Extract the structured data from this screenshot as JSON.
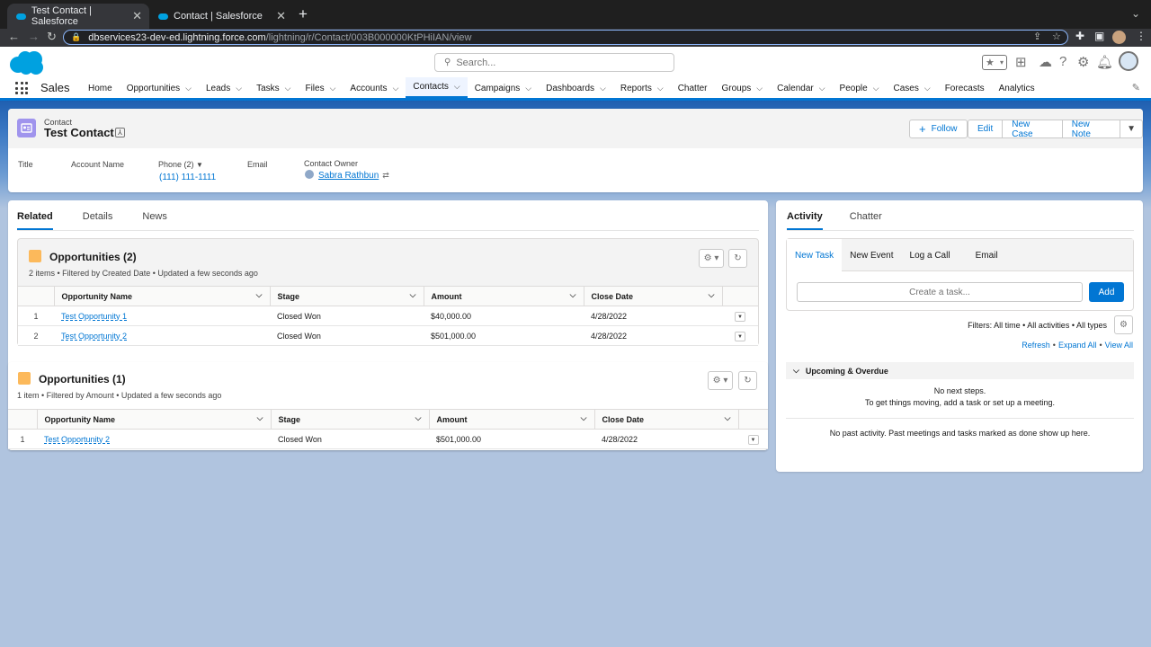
{
  "browser": {
    "tabs": [
      {
        "title": "Test Contact | Salesforce",
        "close": "✕"
      },
      {
        "title": "Contact | Salesforce",
        "close": "✕"
      }
    ],
    "new_tab": "+",
    "url_host": "dbservices23-dev-ed.lightning.force.com",
    "url_path": "/lightning/r/Contact/003B000000KtPHiIAN/view"
  },
  "header": {
    "search_placeholder": "Search...",
    "app_name": "Sales",
    "nav": [
      {
        "label": "Home",
        "dropdown": false
      },
      {
        "label": "Opportunities",
        "dropdown": true
      },
      {
        "label": "Leads",
        "dropdown": true
      },
      {
        "label": "Tasks",
        "dropdown": true
      },
      {
        "label": "Files",
        "dropdown": true
      },
      {
        "label": "Accounts",
        "dropdown": true
      },
      {
        "label": "Contacts",
        "dropdown": true,
        "active": true
      },
      {
        "label": "Campaigns",
        "dropdown": true
      },
      {
        "label": "Dashboards",
        "dropdown": true
      },
      {
        "label": "Reports",
        "dropdown": true
      },
      {
        "label": "Chatter",
        "dropdown": false
      },
      {
        "label": "Groups",
        "dropdown": true
      },
      {
        "label": "Calendar",
        "dropdown": true
      },
      {
        "label": "People",
        "dropdown": true
      },
      {
        "label": "Cases",
        "dropdown": true
      },
      {
        "label": "Forecasts",
        "dropdown": false
      },
      {
        "label": "Analytics",
        "dropdown": false
      }
    ]
  },
  "record": {
    "object_label": "Contact",
    "name": "Test Contact",
    "buttons": {
      "follow": "Follow",
      "edit": "Edit",
      "new_case": "New Case",
      "new_note": "New Note"
    },
    "fields": {
      "title_label": "Title",
      "account_label": "Account Name",
      "phone_label": "Phone (2)",
      "phone_value": "(111) 111-1111",
      "email_label": "Email",
      "owner_label": "Contact Owner",
      "owner_value": "Sabra Rathbun"
    }
  },
  "related": {
    "tabs": [
      "Related",
      "Details",
      "News"
    ],
    "columns": [
      "Opportunity Name",
      "Stage",
      "Amount",
      "Close Date"
    ],
    "list1": {
      "title": "Opportunities (2)",
      "subtitle": "2 items • Filtered by Created Date • Updated a few seconds ago",
      "rows": [
        {
          "num": "1",
          "name": "Test Opportunity 1",
          "stage": "Closed Won",
          "amount": "$40,000.00",
          "close": "4/28/2022"
        },
        {
          "num": "2",
          "name": "Test Opportunity 2",
          "stage": "Closed Won",
          "amount": "$501,000.00",
          "close": "4/28/2022"
        }
      ]
    },
    "list2": {
      "title": "Opportunities (1)",
      "subtitle": "1 item • Filtered by Amount • Updated a few seconds ago",
      "rows": [
        {
          "num": "1",
          "name": "Test Opportunity 2",
          "stage": "Closed Won",
          "amount": "$501,000.00",
          "close": "4/28/2022"
        }
      ]
    }
  },
  "activity": {
    "tabs": [
      "Activity",
      "Chatter"
    ],
    "composer_tabs": [
      "New Task",
      "New Event",
      "Log a Call",
      "Email"
    ],
    "task_placeholder": "Create a task...",
    "add_label": "Add",
    "filters": "Filters: All time • All activities • All types",
    "refresh": "Refresh",
    "expand_all": "Expand All",
    "view_all": "View All",
    "upcoming_label": "Upcoming & Overdue",
    "no_next_steps": "No next steps.",
    "no_next_hint": "To get things moving, add a task or set up a meeting.",
    "no_past": "No past activity. Past meetings and tasks marked as done show up here."
  },
  "colors": {
    "brand": "#0176d3",
    "contact_icon": "#a094ed",
    "opportunity_icon": "#fcb95b"
  }
}
